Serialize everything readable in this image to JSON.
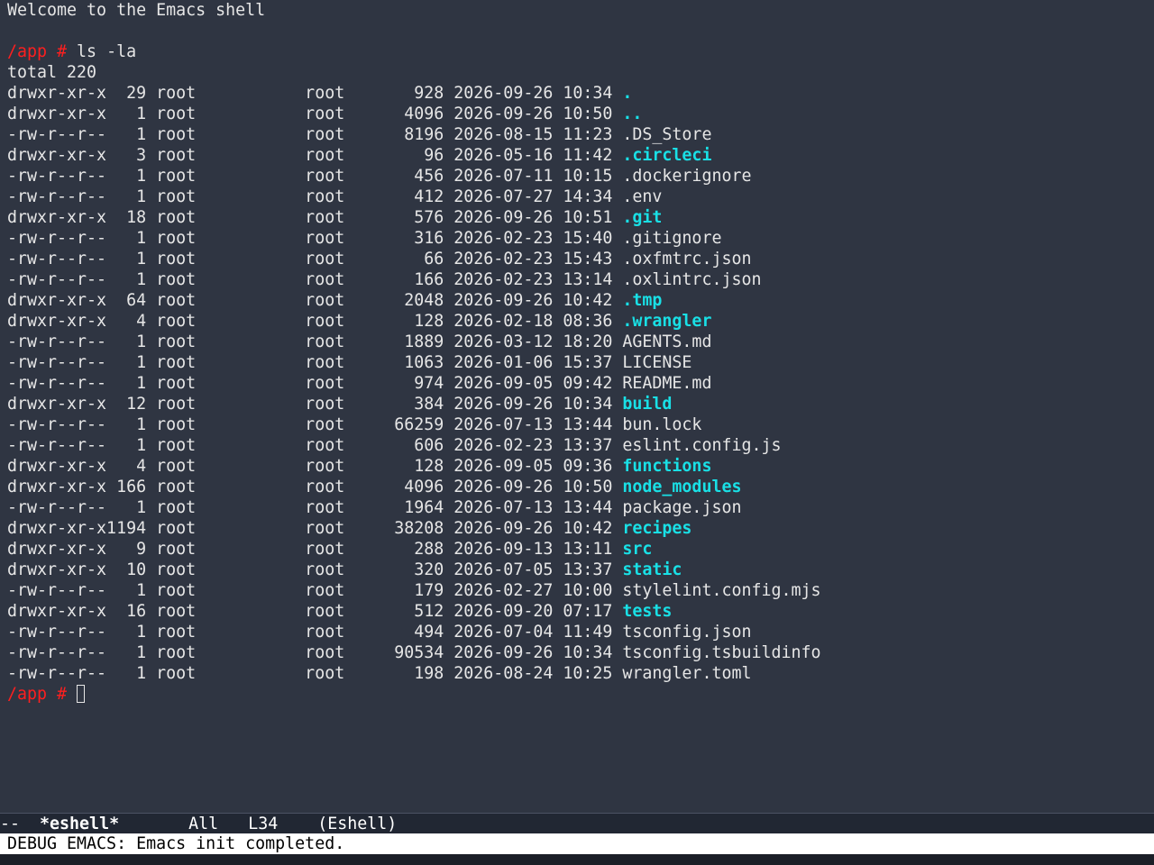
{
  "welcome": "Welcome to the Emacs shell",
  "prompt": "/app #",
  "command": " ls -la",
  "total": "total 220",
  "listing": [
    {
      "meta": "drwxr-xr-x  29 root           root       928 2026-09-26 10:34 ",
      "name": ".",
      "dir": true
    },
    {
      "meta": "drwxr-xr-x   1 root           root      4096 2026-09-26 10:50 ",
      "name": "..",
      "dir": true
    },
    {
      "meta": "-rw-r--r--   1 root           root      8196 2026-08-15 11:23 ",
      "name": ".DS_Store",
      "dir": false
    },
    {
      "meta": "drwxr-xr-x   3 root           root        96 2026-05-16 11:42 ",
      "name": ".circleci",
      "dir": true
    },
    {
      "meta": "-rw-r--r--   1 root           root       456 2026-07-11 10:15 ",
      "name": ".dockerignore",
      "dir": false
    },
    {
      "meta": "-rw-r--r--   1 root           root       412 2026-07-27 14:34 ",
      "name": ".env",
      "dir": false
    },
    {
      "meta": "drwxr-xr-x  18 root           root       576 2026-09-26 10:51 ",
      "name": ".git",
      "dir": true
    },
    {
      "meta": "-rw-r--r--   1 root           root       316 2026-02-23 15:40 ",
      "name": ".gitignore",
      "dir": false
    },
    {
      "meta": "-rw-r--r--   1 root           root        66 2026-02-23 15:43 ",
      "name": ".oxfmtrc.json",
      "dir": false
    },
    {
      "meta": "-rw-r--r--   1 root           root       166 2026-02-23 13:14 ",
      "name": ".oxlintrc.json",
      "dir": false
    },
    {
      "meta": "drwxr-xr-x  64 root           root      2048 2026-09-26 10:42 ",
      "name": ".tmp",
      "dir": true
    },
    {
      "meta": "drwxr-xr-x   4 root           root       128 2026-02-18 08:36 ",
      "name": ".wrangler",
      "dir": true
    },
    {
      "meta": "-rw-r--r--   1 root           root      1889 2026-03-12 18:20 ",
      "name": "AGENTS.md",
      "dir": false
    },
    {
      "meta": "-rw-r--r--   1 root           root      1063 2026-01-06 15:37 ",
      "name": "LICENSE",
      "dir": false
    },
    {
      "meta": "-rw-r--r--   1 root           root       974 2026-09-05 09:42 ",
      "name": "README.md",
      "dir": false
    },
    {
      "meta": "drwxr-xr-x  12 root           root       384 2026-09-26 10:34 ",
      "name": "build",
      "dir": true
    },
    {
      "meta": "-rw-r--r--   1 root           root     66259 2026-07-13 13:44 ",
      "name": "bun.lock",
      "dir": false
    },
    {
      "meta": "-rw-r--r--   1 root           root       606 2026-02-23 13:37 ",
      "name": "eslint.config.js",
      "dir": false
    },
    {
      "meta": "drwxr-xr-x   4 root           root       128 2026-09-05 09:36 ",
      "name": "functions",
      "dir": true
    },
    {
      "meta": "drwxr-xr-x 166 root           root      4096 2026-09-26 10:50 ",
      "name": "node_modules",
      "dir": true
    },
    {
      "meta": "-rw-r--r--   1 root           root      1964 2026-07-13 13:44 ",
      "name": "package.json",
      "dir": false
    },
    {
      "meta": "drwxr-xr-x1194 root           root     38208 2026-09-26 10:42 ",
      "name": "recipes",
      "dir": true
    },
    {
      "meta": "drwxr-xr-x   9 root           root       288 2026-09-13 13:11 ",
      "name": "src",
      "dir": true
    },
    {
      "meta": "drwxr-xr-x  10 root           root       320 2026-07-05 13:37 ",
      "name": "static",
      "dir": true
    },
    {
      "meta": "-rw-r--r--   1 root           root       179 2026-02-27 10:00 ",
      "name": "stylelint.config.mjs",
      "dir": false
    },
    {
      "meta": "drwxr-xr-x  16 root           root       512 2026-09-20 07:17 ",
      "name": "tests",
      "dir": true
    },
    {
      "meta": "-rw-r--r--   1 root           root       494 2026-07-04 11:49 ",
      "name": "tsconfig.json",
      "dir": false
    },
    {
      "meta": "-rw-r--r--   1 root           root     90534 2026-09-26 10:34 ",
      "name": "tsconfig.tsbuildinfo",
      "dir": false
    },
    {
      "meta": "-rw-r--r--   1 root           root       198 2026-08-24 10:25 ",
      "name": "wrangler.toml",
      "dir": false
    }
  ],
  "modeline": {
    "state": "--  ",
    "buffer": "*eshell*",
    "position": "All",
    "line": "L34",
    "mode": "(Eshell)"
  },
  "echo": "DEBUG EMACS: Emacs init completed.",
  "colors": {
    "background": "#2f3542",
    "prompt": "#ff1f1f",
    "directory": "#19e0e6"
  }
}
